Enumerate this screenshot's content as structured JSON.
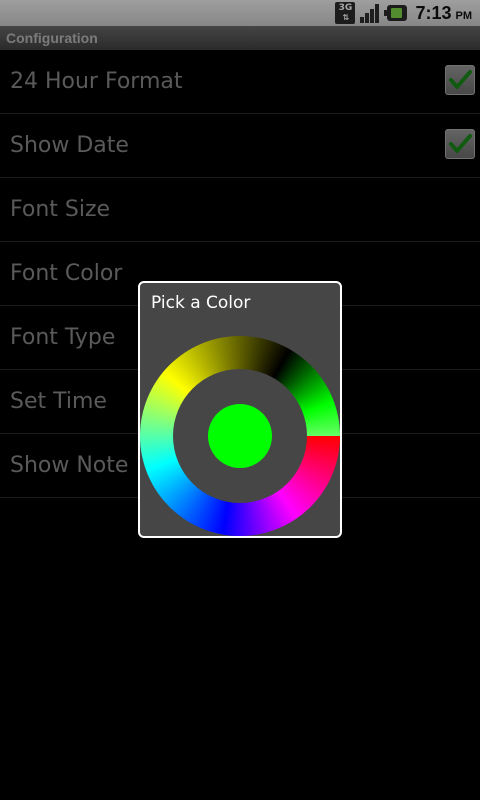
{
  "status_bar": {
    "network_type": "3G",
    "network_arrows": "⇅",
    "time": "7:13",
    "ampm": "PM",
    "icons": [
      "3g-icon",
      "signal-icon",
      "battery-icon"
    ]
  },
  "title_bar": {
    "title": "Configuration"
  },
  "preferences": [
    {
      "label": "24 Hour Format",
      "checked": true
    },
    {
      "label": "Show Date",
      "checked": true
    },
    {
      "label": "Font Size"
    },
    {
      "label": "Font Color"
    },
    {
      "label": "Font Type"
    },
    {
      "label": "Set Time"
    },
    {
      "label": "Show Note"
    }
  ],
  "dialog": {
    "title": "Pick a Color",
    "selected_color": "#00ff00"
  },
  "colors": {
    "checkmark": "#1a8c1a",
    "dialog_bg": "#474647"
  }
}
